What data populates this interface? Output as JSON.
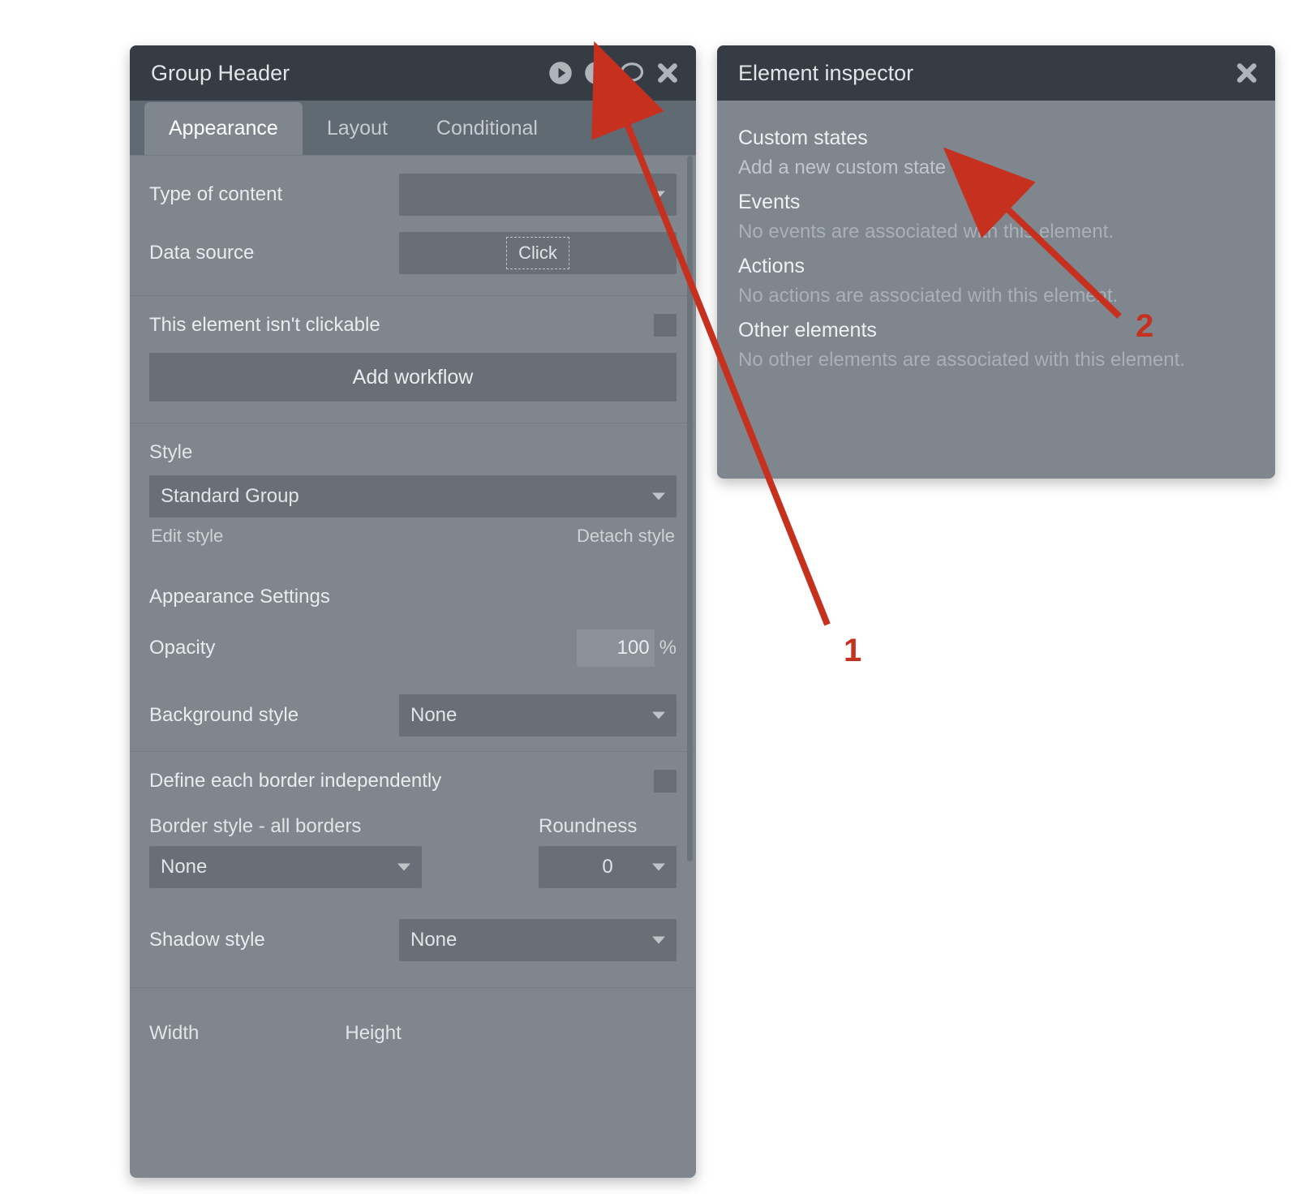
{
  "property_panel": {
    "title": "Group Header",
    "tabs": [
      {
        "label": "Appearance",
        "active": true
      },
      {
        "label": "Layout",
        "active": false
      },
      {
        "label": "Conditional",
        "active": false
      }
    ],
    "type_of_content": {
      "label": "Type of content",
      "value": ""
    },
    "data_source": {
      "label": "Data source",
      "placeholder": "Click"
    },
    "clickable_note": "This element isn't clickable",
    "add_workflow_btn": "Add workflow",
    "style": {
      "label": "Style",
      "value": "Standard Group",
      "edit_link": "Edit style",
      "detach_link": "Detach style"
    },
    "appearance_settings_label": "Appearance Settings",
    "opacity": {
      "label": "Opacity",
      "value": "100",
      "unit": "%"
    },
    "background_style": {
      "label": "Background style",
      "value": "None"
    },
    "define_each_border_label": "Define each border independently",
    "border_style_label": "Border style - all borders",
    "border_style_value": "None",
    "roundness_label": "Roundness",
    "roundness_value": "0",
    "shadow_style": {
      "label": "Shadow style",
      "value": "None"
    },
    "width_label": "Width",
    "height_label": "Height"
  },
  "inspector_panel": {
    "title": "Element inspector",
    "custom_states": {
      "title": "Custom states",
      "add_link": "Add a new custom state"
    },
    "events": {
      "title": "Events",
      "text": "No events are associated with this element."
    },
    "actions": {
      "title": "Actions",
      "text": "No actions are associated with this element."
    },
    "other": {
      "title": "Other elements",
      "text": "No other elements are associated with this element."
    }
  },
  "annotations": {
    "label1": "1",
    "label2": "2"
  },
  "colors": {
    "arrow": "#c6311f"
  }
}
